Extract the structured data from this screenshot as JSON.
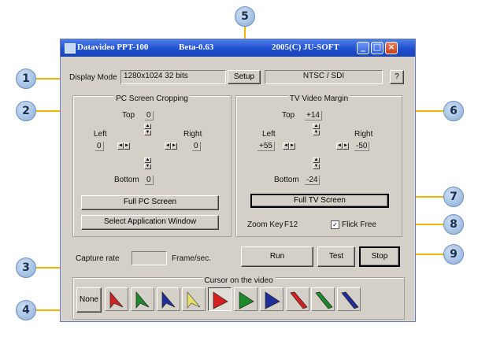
{
  "window": {
    "title_app": "Datavideo PPT-100",
    "title_version": "Beta-0.63",
    "title_copyright": "2005(C) JU-SOFT"
  },
  "top": {
    "display_mode_label": "Display Mode",
    "display_mode_value": "1280x1024 32 bits",
    "setup_label": "Setup",
    "output_value": "NTSC / SDI",
    "help_label": "?"
  },
  "pc": {
    "title": "PC Screen Cropping",
    "top_label": "Top",
    "top_value": "0",
    "left_label": "Left",
    "left_value": "0",
    "right_label": "Right",
    "right_value": "0",
    "bottom_label": "Bottom",
    "bottom_value": "0",
    "full_btn": "Full PC Screen",
    "select_btn": "Select Application Window"
  },
  "tv": {
    "title": "TV Video Margin",
    "top_label": "Top",
    "top_value": "+14",
    "left_label": "Left",
    "left_value": "+55",
    "right_label": "Right",
    "right_value": "-50",
    "bottom_label": "Bottom",
    "bottom_value": "-24",
    "full_btn": "Full TV Screen",
    "zoom_label": "Zoom Key",
    "zoom_value": "F12",
    "flick_label": "Flick Free",
    "flick_checked": true
  },
  "capture": {
    "label": "Capture rate",
    "value": "",
    "unit": "Frame/sec."
  },
  "controls": {
    "run": "Run",
    "test": "Test",
    "stop": "Stop"
  },
  "cursor": {
    "title": "Cursor on the video",
    "none_label": "None",
    "options": [
      {
        "name": "red-arrow",
        "color": "#d42020"
      },
      {
        "name": "green-arrow",
        "color": "#1a8a2a"
      },
      {
        "name": "blue-arrow",
        "color": "#1e2f9a"
      },
      {
        "name": "yellow-arrow",
        "color": "#e8e060"
      },
      {
        "name": "red-triangle",
        "color": "#d42020"
      },
      {
        "name": "green-triangle",
        "color": "#1a8a2a"
      },
      {
        "name": "blue-triangle",
        "color": "#1e2f9a"
      },
      {
        "name": "red-wedge",
        "color": "#d42020"
      },
      {
        "name": "green-wedge",
        "color": "#1a8a2a"
      },
      {
        "name": "blue-wedge",
        "color": "#1e2f9a"
      }
    ],
    "selected_index": 4
  },
  "callouts": [
    "1",
    "2",
    "3",
    "4",
    "5",
    "6",
    "7",
    "8",
    "9"
  ],
  "accent_color": "#f2b400"
}
